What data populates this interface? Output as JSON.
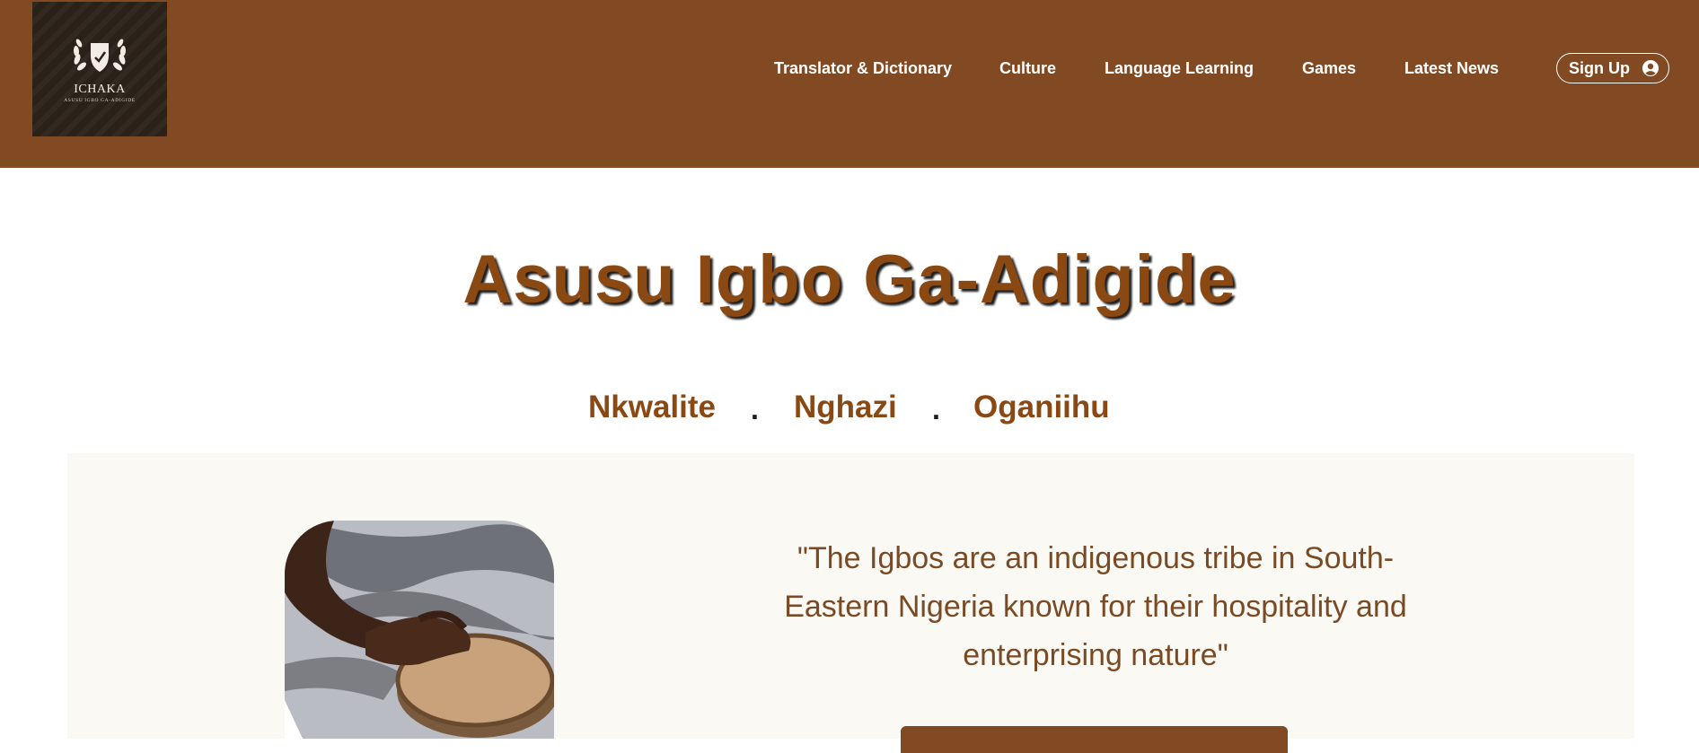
{
  "header": {
    "logo": {
      "name": "ICHAKA",
      "tagline": "ASUSU IGBO GA-ADIGIDE",
      "icon": "laurel-shield-icon"
    },
    "nav": [
      {
        "label": "Translator & Dictionary"
      },
      {
        "label": "Culture"
      },
      {
        "label": "Language Learning"
      },
      {
        "label": "Games"
      },
      {
        "label": "Latest News"
      }
    ],
    "signup": {
      "label": "Sign Up",
      "icon": "user-circle-icon"
    }
  },
  "hero": {
    "title": "Asusu Igbo Ga-Adigide",
    "tagline": [
      "Nkwalite",
      "Nghazi",
      "Oganiihu"
    ],
    "separator": "."
  },
  "feature": {
    "quote": "\"The Igbos are an indigenous tribe in South-Eastern Nigeria known for their hospitality and enterprising nature\"",
    "image_alt": "hands-playing-drum"
  },
  "colors": {
    "brand": "#824a22",
    "title": "#8a4813",
    "quote": "#7a4a24",
    "panel": "#fbf9f3"
  }
}
